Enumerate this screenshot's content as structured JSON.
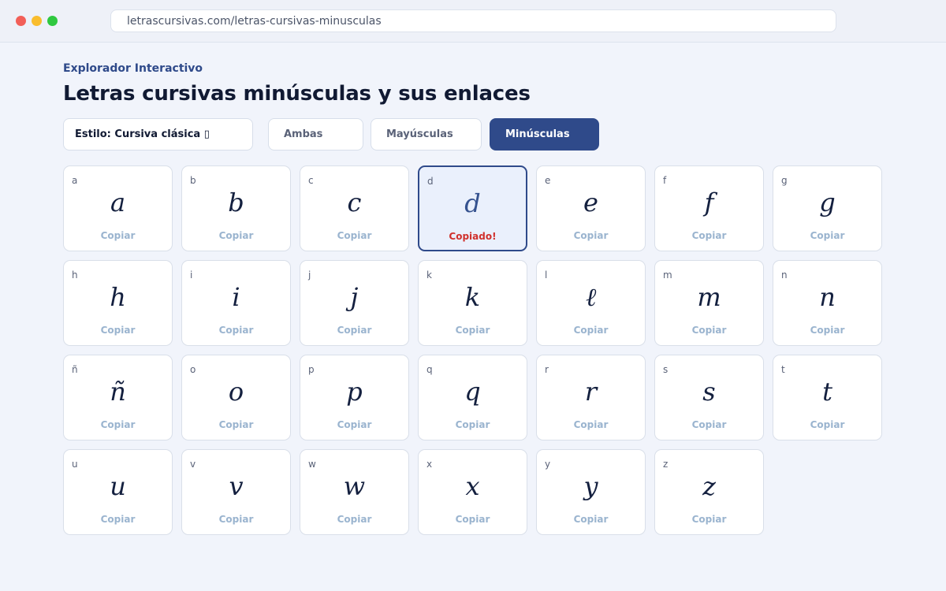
{
  "browser": {
    "url": "letrascursivas.com/letras-cursivas-minusculas"
  },
  "header": {
    "kicker": "Explorador Interactivo",
    "title": "Letras cursivas minúsculas y sus enlaces"
  },
  "controls": {
    "style_select": "Estilo: Cursiva clásica ▯",
    "filters": [
      {
        "label": "Ambas",
        "active": false
      },
      {
        "label": "Mayúsculas",
        "active": false
      },
      {
        "label": "Minúsculas",
        "active": true
      }
    ]
  },
  "colors": {
    "accent": "#2f4a8a",
    "copied": "#d0312d",
    "copy_link": "#9ab4cf"
  },
  "letters": [
    {
      "key": "a",
      "glyph": "a",
      "action": "Copiar"
    },
    {
      "key": "b",
      "glyph": "b",
      "action": "Copiar"
    },
    {
      "key": "c",
      "glyph": "c",
      "action": "Copiar"
    },
    {
      "key": "d",
      "glyph": "d",
      "action": "Copiado!",
      "selected": true
    },
    {
      "key": "e",
      "glyph": "e",
      "action": "Copiar"
    },
    {
      "key": "f",
      "glyph": "f",
      "action": "Copiar"
    },
    {
      "key": "g",
      "glyph": "g",
      "action": "Copiar"
    },
    {
      "key": "h",
      "glyph": "h",
      "action": "Copiar"
    },
    {
      "key": "i",
      "glyph": "i",
      "action": "Copiar"
    },
    {
      "key": "j",
      "glyph": "j",
      "action": "Copiar"
    },
    {
      "key": "k",
      "glyph": "k",
      "action": "Copiar"
    },
    {
      "key": "l",
      "glyph": "ℓ",
      "action": "Copiar"
    },
    {
      "key": "m",
      "glyph": "m",
      "action": "Copiar"
    },
    {
      "key": "n",
      "glyph": "n",
      "action": "Copiar"
    },
    {
      "key": "ñ",
      "glyph": "ñ",
      "action": "Copiar"
    },
    {
      "key": "o",
      "glyph": "o",
      "action": "Copiar"
    },
    {
      "key": "p",
      "glyph": "p",
      "action": "Copiar"
    },
    {
      "key": "q",
      "glyph": "q",
      "action": "Copiar"
    },
    {
      "key": "r",
      "glyph": "r",
      "action": "Copiar"
    },
    {
      "key": "s",
      "glyph": "s",
      "action": "Copiar"
    },
    {
      "key": "t",
      "glyph": "t",
      "action": "Copiar"
    },
    {
      "key": "u",
      "glyph": "u",
      "action": "Copiar"
    },
    {
      "key": "v",
      "glyph": "v",
      "action": "Copiar"
    },
    {
      "key": "w",
      "glyph": "w",
      "action": "Copiar"
    },
    {
      "key": "x",
      "glyph": "x",
      "action": "Copiar"
    },
    {
      "key": "y",
      "glyph": "y",
      "action": "Copiar"
    },
    {
      "key": "z",
      "glyph": "z",
      "action": "Copiar"
    }
  ]
}
